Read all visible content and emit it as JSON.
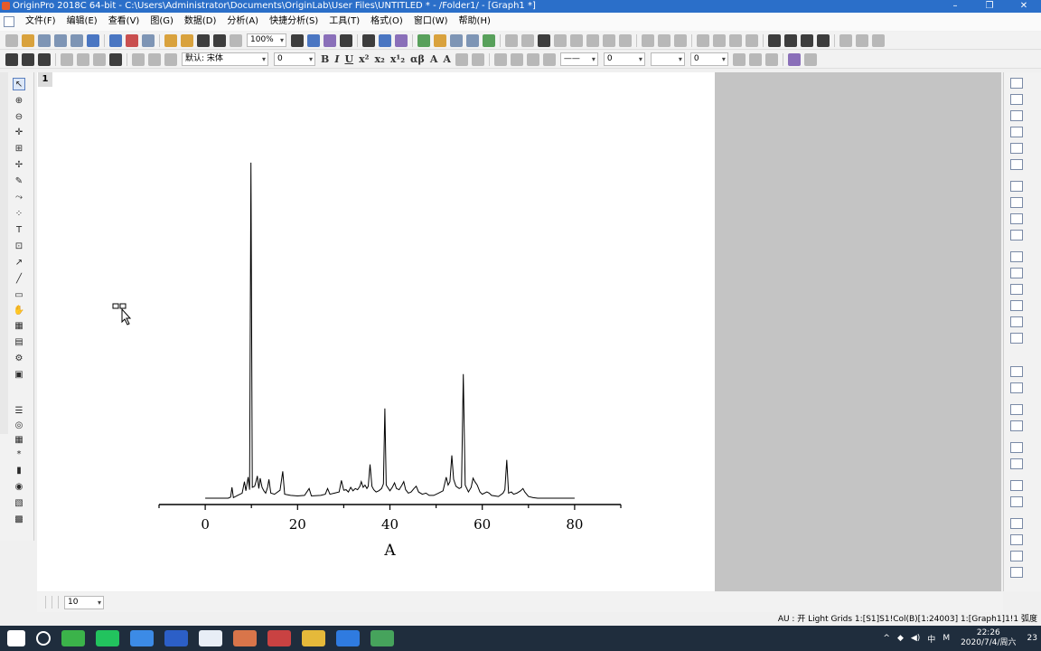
{
  "window": {
    "title": "OriginPro 2018C 64-bit - C:\\Users\\Administrator\\Documents\\OriginLab\\User Files\\UNTITLED * - /Folder1/ - [Graph1 *]",
    "buttons": [
      "–",
      "❐",
      "✕"
    ]
  },
  "menu": {
    "items": [
      "文件(F)",
      "编辑(E)",
      "查看(V)",
      "图(G)",
      "数据(D)",
      "分析(A)",
      "快捷分析(S)",
      "工具(T)",
      "格式(O)",
      "窗口(W)",
      "帮助(H)"
    ]
  },
  "toolbar": {
    "zoom": "100%",
    "font": "默认: 宋体",
    "font_size": "0",
    "format_buttons": [
      "B",
      "I",
      "U",
      "x²",
      "x₂",
      "x¹₂",
      "αβ",
      "A",
      "A"
    ],
    "line_width": "0",
    "line_size_2": "0",
    "bottom_size": "10"
  },
  "graph": {
    "layer_label": "1"
  },
  "chart_data": {
    "type": "line",
    "xlabel": "A",
    "ylabel": "",
    "xlim": [
      -10,
      90
    ],
    "ylim": [
      -10,
      610
    ],
    "xticks": [
      0,
      20,
      40,
      60,
      80
    ],
    "grid": false,
    "legend": "none",
    "series": [
      {
        "line_color": "#000000",
        "points": [
          [
            0,
            1
          ],
          [
            5,
            1
          ],
          [
            5.5,
            3
          ],
          [
            5.8,
            20
          ],
          [
            6.1,
            2
          ],
          [
            7,
            6
          ],
          [
            8,
            10
          ],
          [
            8.5,
            30
          ],
          [
            8.8,
            14
          ],
          [
            9.3,
            38
          ],
          [
            9.6,
            16
          ],
          [
            9.9,
            588
          ],
          [
            10.2,
            20
          ],
          [
            10.7,
            22
          ],
          [
            11,
            30
          ],
          [
            11.3,
            40
          ],
          [
            11.6,
            18
          ],
          [
            11.9,
            36
          ],
          [
            12.3,
            20
          ],
          [
            12.7,
            14
          ],
          [
            13.1,
            10
          ],
          [
            13.5,
            20
          ],
          [
            13.8,
            34
          ],
          [
            14.2,
            10
          ],
          [
            15,
            8
          ],
          [
            16.2,
            15
          ],
          [
            16.8,
            48
          ],
          [
            17.2,
            8
          ],
          [
            18.5,
            6
          ],
          [
            20,
            5
          ],
          [
            21.5,
            6
          ],
          [
            22.5,
            18
          ],
          [
            23,
            5
          ],
          [
            25,
            6
          ],
          [
            26,
            8
          ],
          [
            26.5,
            18
          ],
          [
            27,
            8
          ],
          [
            28,
            10
          ],
          [
            29,
            12
          ],
          [
            29.5,
            32
          ],
          [
            30,
            15
          ],
          [
            30.5,
            16
          ],
          [
            31,
            12
          ],
          [
            31.5,
            20
          ],
          [
            32,
            14
          ],
          [
            32.5,
            18
          ],
          [
            33,
            16
          ],
          [
            33.5,
            22
          ],
          [
            33.8,
            30
          ],
          [
            34.2,
            20
          ],
          [
            34.6,
            24
          ],
          [
            35,
            18
          ],
          [
            35.3,
            22
          ],
          [
            35.7,
            60
          ],
          [
            36.1,
            22
          ],
          [
            36.5,
            16
          ],
          [
            37,
            12
          ],
          [
            37.6,
            14
          ],
          [
            38.2,
            18
          ],
          [
            38.6,
            26
          ],
          [
            38.9,
            158
          ],
          [
            39.2,
            24
          ],
          [
            40,
            14
          ],
          [
            40.5,
            20
          ],
          [
            41,
            28
          ],
          [
            41.4,
            18
          ],
          [
            42,
            16
          ],
          [
            42.6,
            24
          ],
          [
            43,
            30
          ],
          [
            43.4,
            16
          ],
          [
            44,
            10
          ],
          [
            44.6,
            12
          ],
          [
            45.2,
            18
          ],
          [
            45.7,
            22
          ],
          [
            46.2,
            12
          ],
          [
            47,
            8
          ],
          [
            47.8,
            10
          ],
          [
            48.5,
            6
          ],
          [
            49.5,
            6
          ],
          [
            50.5,
            10
          ],
          [
            51.5,
            14
          ],
          [
            52.2,
            38
          ],
          [
            52.6,
            24
          ],
          [
            53,
            30
          ],
          [
            53.4,
            76
          ],
          [
            53.8,
            34
          ],
          [
            54.3,
            22
          ],
          [
            55,
            18
          ],
          [
            55.5,
            20
          ],
          [
            55.9,
            218
          ],
          [
            56.3,
            24
          ],
          [
            57,
            12
          ],
          [
            57.6,
            20
          ],
          [
            58,
            36
          ],
          [
            58.4,
            30
          ],
          [
            58.9,
            24
          ],
          [
            59.5,
            12
          ],
          [
            60,
            8
          ],
          [
            61,
            12
          ],
          [
            61.5,
            10
          ],
          [
            62,
            6
          ],
          [
            63.5,
            4
          ],
          [
            64.5,
            10
          ],
          [
            64.9,
            16
          ],
          [
            65.3,
            68
          ],
          [
            65.7,
            10
          ],
          [
            66.3,
            12
          ],
          [
            66.8,
            8
          ],
          [
            67.5,
            10
          ],
          [
            68.3,
            14
          ],
          [
            68.8,
            18
          ],
          [
            69.2,
            12
          ],
          [
            70,
            4
          ],
          [
            71,
            2
          ],
          [
            72,
            1
          ],
          [
            75,
            1
          ],
          [
            80,
            1
          ]
        ]
      }
    ]
  },
  "status": {
    "text": "AU : 开  Light Grids  1:[S1]S1!Col(B)[1:24003]  1:[Graph1]1!1  弧度"
  },
  "taskbar": {
    "time": "22:26",
    "date": "2020/7/4/周六",
    "ime": "中",
    "ime2": "M",
    "notif_count": "23"
  }
}
